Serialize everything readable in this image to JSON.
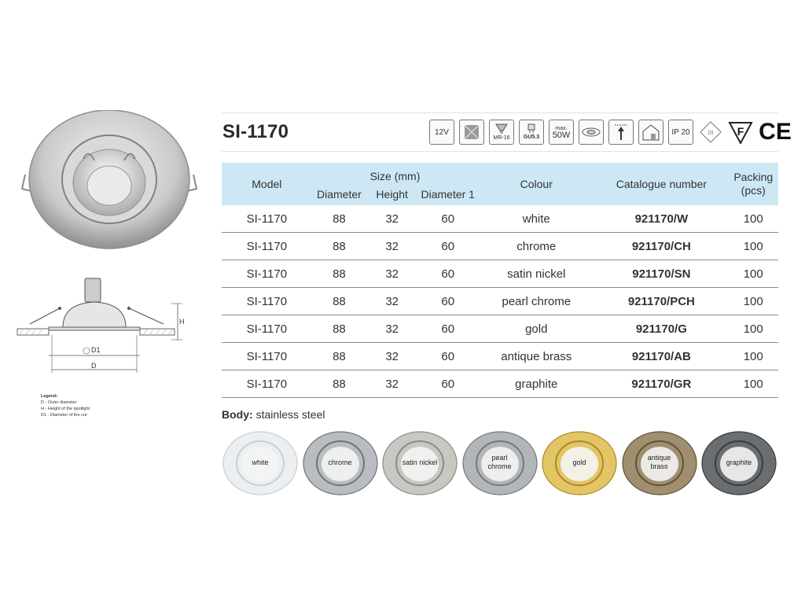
{
  "model_title": "SI-1170",
  "icons": [
    {
      "name": "12v-icon",
      "text": "12V"
    },
    {
      "name": "class-iii-box-icon",
      "text": ""
    },
    {
      "name": "mr16-icon",
      "text": "MR-16"
    },
    {
      "name": "gu53-icon",
      "text": "GU5.3"
    },
    {
      "name": "max-50w-icon",
      "text_top": "max.",
      "text": "50W"
    },
    {
      "name": "recessed-ceiling-icon",
      "text": ""
    },
    {
      "name": "up-arrow-icon",
      "text": ""
    },
    {
      "name": "indoor-house-icon",
      "text": ""
    },
    {
      "name": "ip20-icon",
      "text": "IP 20"
    },
    {
      "name": "class-iii-diamond-icon",
      "text": "III"
    },
    {
      "name": "f-mark-icon",
      "text": "F"
    },
    {
      "name": "ce-mark-icon",
      "text": "CE"
    }
  ],
  "table": {
    "headers": {
      "model": "Model",
      "size": "Size (mm)",
      "diameter": "Diameter",
      "height": "Height",
      "diameter1": "Diameter 1",
      "colour": "Colour",
      "catalogue": "Catalogue number",
      "packing": "Packing",
      "packing_unit": "(pcs)"
    },
    "rows": [
      {
        "model": "SI-1170",
        "diameter": "88",
        "height": "32",
        "diameter1": "60",
        "colour": "white",
        "catalogue": "921170/W",
        "packing": "100"
      },
      {
        "model": "SI-1170",
        "diameter": "88",
        "height": "32",
        "diameter1": "60",
        "colour": "chrome",
        "catalogue": "921170/CH",
        "packing": "100"
      },
      {
        "model": "SI-1170",
        "diameter": "88",
        "height": "32",
        "diameter1": "60",
        "colour": "satin nickel",
        "catalogue": "921170/SN",
        "packing": "100"
      },
      {
        "model": "SI-1170",
        "diameter": "88",
        "height": "32",
        "diameter1": "60",
        "colour": "pearl chrome",
        "catalogue": "921170/PCH",
        "packing": "100"
      },
      {
        "model": "SI-1170",
        "diameter": "88",
        "height": "32",
        "diameter1": "60",
        "colour": "gold",
        "catalogue": "921170/G",
        "packing": "100"
      },
      {
        "model": "SI-1170",
        "diameter": "88",
        "height": "32",
        "diameter1": "60",
        "colour": "antique brass",
        "catalogue": "921170/AB",
        "packing": "100"
      },
      {
        "model": "SI-1170",
        "diameter": "88",
        "height": "32",
        "diameter1": "60",
        "colour": "graphite",
        "catalogue": "921170/GR",
        "packing": "100"
      }
    ]
  },
  "body": {
    "label": "Body:",
    "value": "stainless steel"
  },
  "drawing": {
    "h_label": "H",
    "d1_label": "D1",
    "d_label": "D"
  },
  "legend": {
    "title": "Legend:",
    "items": [
      "D - Outer diameter",
      "H - Height of the spotlight",
      "D1 - Diameter of the cut"
    ]
  },
  "swatches": [
    {
      "line1": "white",
      "line2": "",
      "color": "#eceff1",
      "edge": "#c9ced2"
    },
    {
      "line1": "chrome",
      "line2": "",
      "color": "#b9bdc1",
      "edge": "#6f7478"
    },
    {
      "line1": "satin nickel",
      "line2": "",
      "color": "#c9c7c2",
      "edge": "#8d8b86"
    },
    {
      "line1": "pearl",
      "line2": "chrome",
      "color": "#b3b6b8",
      "edge": "#74787b"
    },
    {
      "line1": "gold",
      "line2": "",
      "color": "#e3c565",
      "edge": "#a88a2a"
    },
    {
      "line1": "antique",
      "line2": "brass",
      "color": "#a08f6e",
      "edge": "#5f523a"
    },
    {
      "line1": "graphite",
      "line2": "",
      "color": "#6b6e70",
      "edge": "#3a3c3e"
    }
  ]
}
